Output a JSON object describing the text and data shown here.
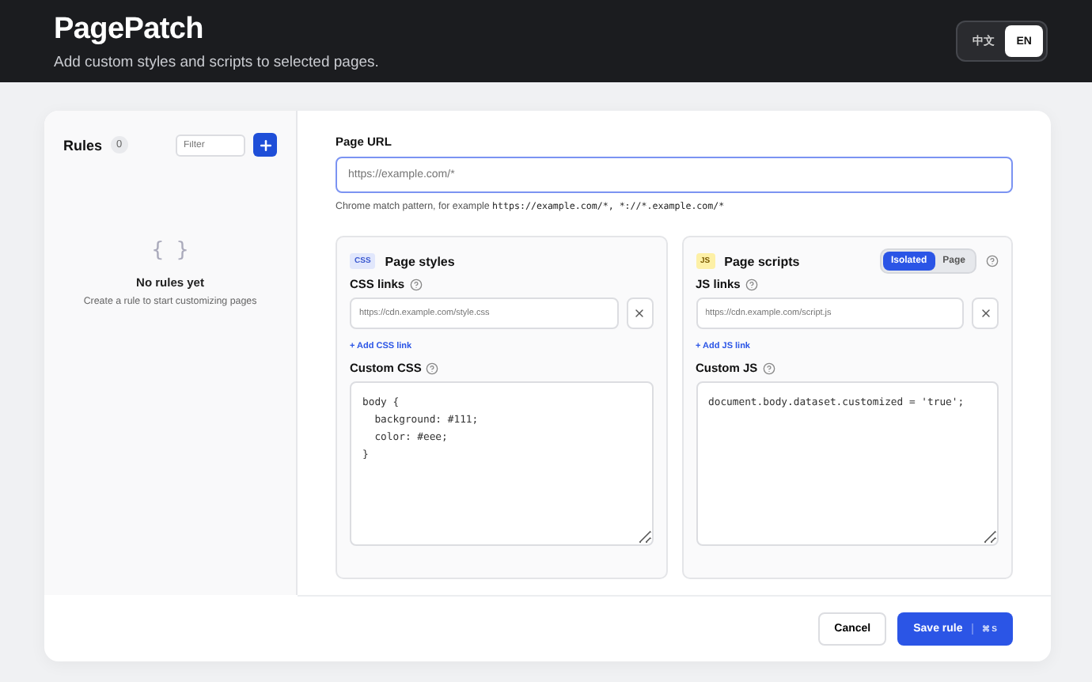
{
  "header": {
    "title": "PagePatch",
    "subtitle": "Add custom styles and scripts to selected pages.",
    "languages": [
      {
        "label": "中文",
        "selected": false
      },
      {
        "label": "EN",
        "selected": true
      }
    ]
  },
  "sidebar": {
    "title": "Rules",
    "count": "0",
    "filter_placeholder": "Filter",
    "empty_icon": "{ }",
    "empty_title": "No rules yet",
    "empty_text": "Create a rule to start customizing pages"
  },
  "page_url": {
    "label": "Page URL",
    "placeholder": "https://example.com/*",
    "hint": "Chrome match pattern, for example ",
    "hint_code": "https://example.com/*, *://*.example.com/*"
  },
  "panels": [
    {
      "badge": "CSS",
      "kind": "css",
      "title": "Page styles",
      "links_label": "CSS links",
      "link_placeholder": "https://cdn.example.com/style.css",
      "add_link": "+ Add CSS link",
      "code_label": "Custom CSS",
      "code": "body {\n  background: #111;\n  color: #eee;\n}"
    },
    {
      "badge": "JS",
      "kind": "js",
      "title": "Page scripts",
      "modes": [
        {
          "label": "Isolated",
          "selected": true
        },
        {
          "label": "Page",
          "selected": false
        }
      ],
      "links_label": "JS links",
      "link_placeholder": "https://cdn.example.com/script.js",
      "add_link": "+ Add JS link",
      "code_label": "Custom JS",
      "code": "document.body.dataset.customized = 'true';"
    }
  ],
  "footer": {
    "cancel": "Cancel",
    "save": "Save rule",
    "shortcut": "⌘ S"
  }
}
